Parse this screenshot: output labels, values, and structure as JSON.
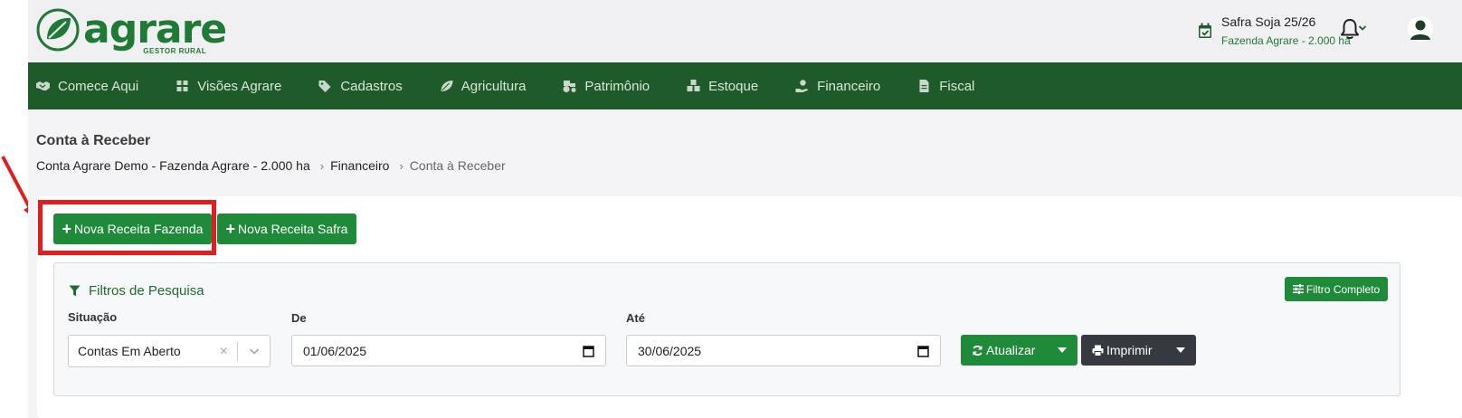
{
  "brand": {
    "name": "agrare",
    "tagline": "GESTOR RURAL",
    "color": "#1e7a35"
  },
  "header": {
    "season_title": "Safra Soja 25/26",
    "season_farm": "Fazenda Agrare - 2.000 ha",
    "icons": [
      "calendar-check-icon",
      "chevron-down-icon",
      "bell-icon",
      "user-icon"
    ]
  },
  "nav": {
    "background": "#1f5b2a",
    "items": [
      {
        "label": "Comece Aqui",
        "icon": "handshake-icon"
      },
      {
        "label": "Visões Agrare",
        "icon": "grid-icon"
      },
      {
        "label": "Cadastros",
        "icon": "tags-icon"
      },
      {
        "label": "Agricultura",
        "icon": "leaf-icon"
      },
      {
        "label": "Patrimônio",
        "icon": "tractor-icon"
      },
      {
        "label": "Estoque",
        "icon": "boxes-icon"
      },
      {
        "label": "Financeiro",
        "icon": "hand-coin-icon"
      },
      {
        "label": "Fiscal",
        "icon": "invoice-icon"
      }
    ]
  },
  "page": {
    "title": "Conta à Receber",
    "breadcrumb": [
      "Conta Agrare Demo - Fazenda Agrare - 2.000 ha",
      "Financeiro",
      "Conta à Receber"
    ]
  },
  "actions": {
    "nova_receita_fazenda": "Nova Receita Fazenda",
    "nova_receita_safra": "Nova Receita Safra",
    "accent": "#1f8a3a",
    "highlight_color": "#e11d1d"
  },
  "filters": {
    "title": "Filtros de Pesquisa",
    "full_filter_label": "Filtro Completo",
    "situacao_label": "Situação",
    "situacao_value": "Contas Em Aberto",
    "de_label": "De",
    "de_value": "01/06/2025",
    "ate_label": "Até",
    "ate_value": "30/06/2025",
    "atualizar_label": "Atualizar",
    "imprimir_label": "Imprimir"
  }
}
